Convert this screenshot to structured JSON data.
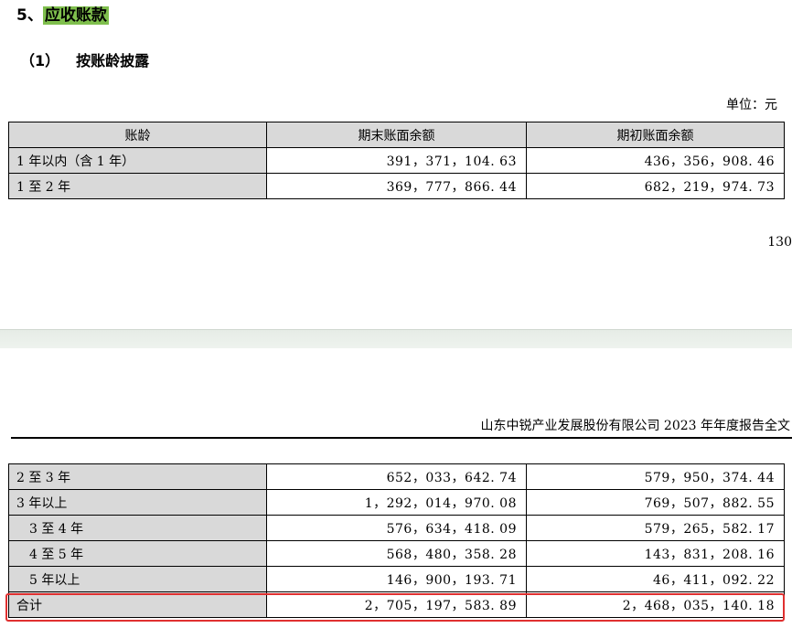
{
  "section_title": {
    "number": "5、",
    "text": "应收账款"
  },
  "subtitle": {
    "paren": "（1）",
    "text": "按账龄披露"
  },
  "unit": "单位：元",
  "table1": {
    "headers": [
      "账龄",
      "期末账面余额",
      "期初账面余额"
    ],
    "rows": [
      {
        "label": "1 年以内（含 1 年）",
        "end": "391，371，104. 63",
        "begin": "436，356，908. 46"
      },
      {
        "label": "1 至 2 年",
        "end": "369，777，866. 44",
        "begin": "682，219，974. 73"
      }
    ]
  },
  "page_number": "130",
  "report_header": "山东中锐产业发展股份有限公司 2023 年年度报告全文",
  "table2": {
    "rows": [
      {
        "label": "2 至 3 年",
        "end": "652，033，642. 74",
        "begin": "579，950，374. 44"
      },
      {
        "label": "3 年以上",
        "end": "1，292，014，970. 08",
        "begin": "769，507，882. 55"
      },
      {
        "label": "3 至 4 年",
        "end": "576，634，418. 09",
        "begin": "579，265，582. 17"
      },
      {
        "label": "4 至 5 年",
        "end": "568，480，358. 28",
        "begin": "143，831，208. 16"
      },
      {
        "label": "5 年以上",
        "end": "146，900，193. 71",
        "begin": "46，411，092. 22"
      },
      {
        "label": "合计",
        "end": "2，705，197，583. 89",
        "begin": "2，468，035，140. 18"
      }
    ]
  },
  "colors": {
    "highlight": "#7fbf4d",
    "total_box": "#e03030",
    "header_bg": "#d9d9d9"
  }
}
